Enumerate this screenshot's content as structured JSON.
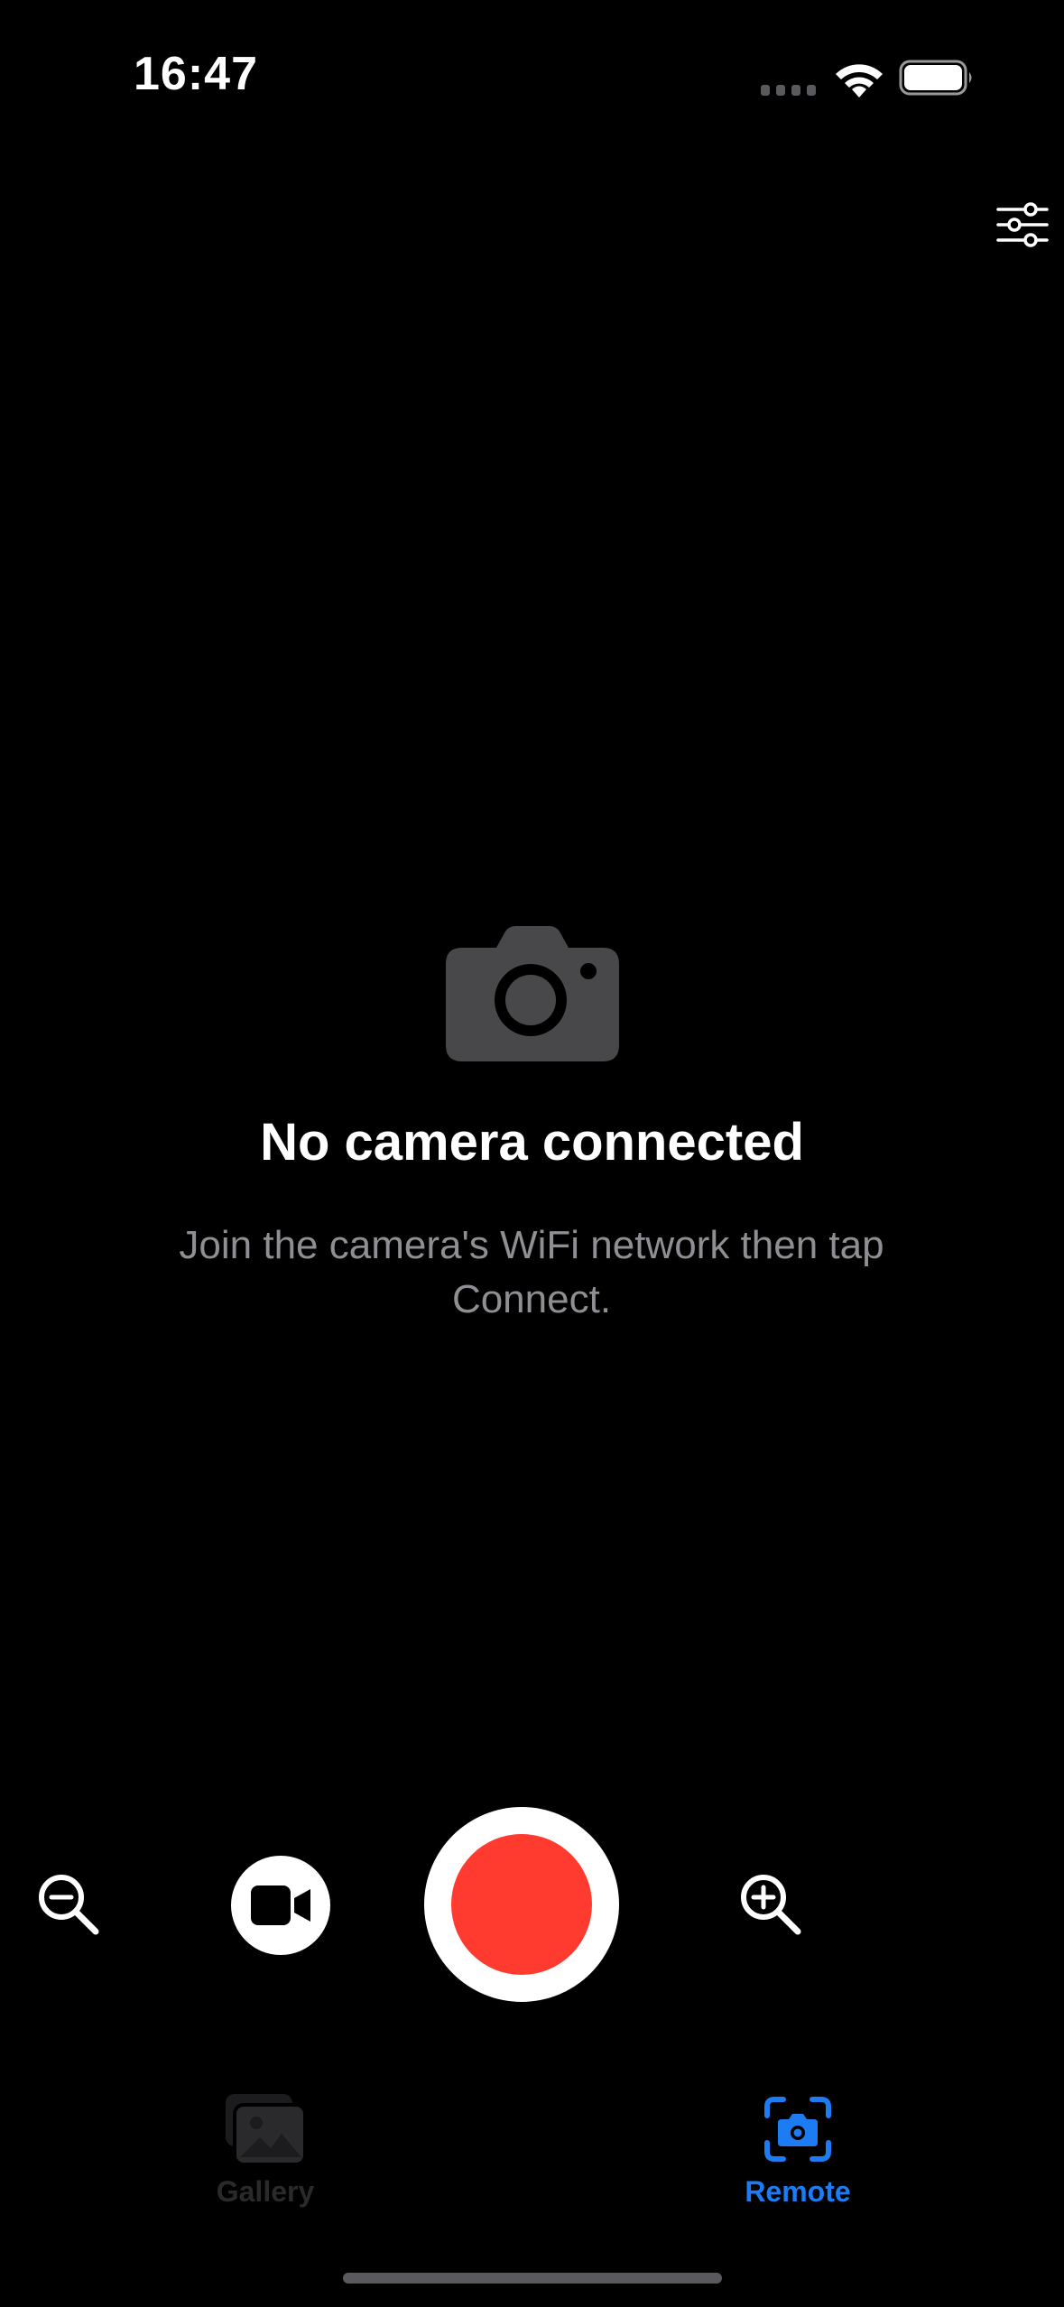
{
  "status_bar": {
    "time": "16:47"
  },
  "empty_state": {
    "icon": "camera-icon",
    "title": "No camera connected",
    "subtitle": "Join the camera's WiFi network then tap Connect."
  },
  "controls": {
    "zoom_out_icon": "zoom-out-icon",
    "video_mode_icon": "video-camera-icon",
    "zoom_in_icon": "zoom-in-icon"
  },
  "tab_bar": {
    "tabs": [
      {
        "label": "Gallery",
        "icon": "gallery-icon",
        "active": false
      },
      {
        "label": "Remote",
        "icon": "remote-camera-icon",
        "active": true
      }
    ]
  },
  "colors": {
    "background": "#000000",
    "record": "#ff3b30",
    "accent": "#1d7cf2",
    "subtitle": "#8e8e93",
    "inactive_tab": "#2a2a2c",
    "empty_icon": "#48484a"
  }
}
